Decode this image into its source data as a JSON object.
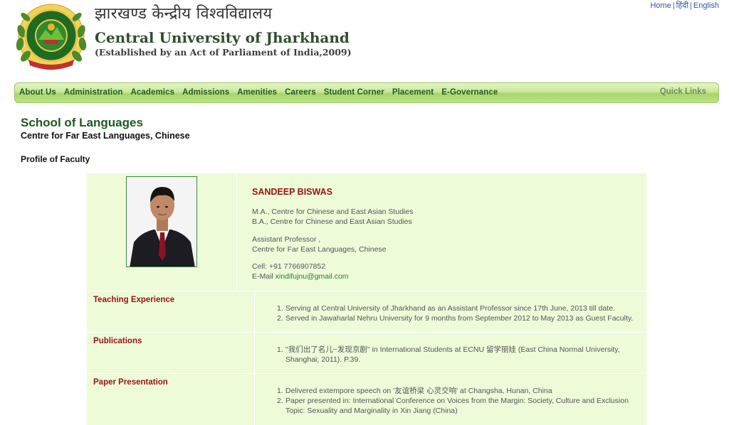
{
  "header": {
    "title_hindi": "झारखण्ड केन्द्रीय विश्वविद्यालय",
    "title_en": "Central University of Jharkhand",
    "subtitle": "(Established by an Act of Parliament of India,2009)",
    "toplinks": [
      "Home",
      "हिंदी",
      "English"
    ]
  },
  "nav": {
    "items": [
      "About Us",
      "Administration",
      "Academics",
      "Admissions",
      "Amenities",
      "Careers",
      "Student Corner",
      "Placement",
      "E-Governance"
    ],
    "quick_links": "Quick Links"
  },
  "page": {
    "school": "School of Languages",
    "centre": "Centre for Far East Languages, Chinese",
    "profile_heading": "Profile of Faculty"
  },
  "profile": {
    "name": "SANDEEP BISWAS",
    "qualifications": [
      "M.A., Centre for Chinese and East Asian Studies",
      "B.A., Centre for Chinese and East Asian Studies"
    ],
    "designation": "Assistant Professor ,",
    "department": "Centre for Far East Languages, Chinese",
    "cell": "Cell: +91 7766907852",
    "email_label": "E-Mail ",
    "email": "xindifujnu@gmail.com"
  },
  "sections": [
    {
      "label": "Teaching Experience",
      "items": [
        "Serving at Central University of Jharkhand as an Assistant Professor since 17th June, 2013 till date.",
        "Served in Jawaharlal Nehru University for 9 months from September 2012 to May 2013 as Guest Faculty."
      ]
    },
    {
      "label": "Publications",
      "items": [
        "\"我们出了名儿~发现京剧\" in International Students at ECNU 留学丽娃 (East China Normal University, Shanghai; 2011). P.39."
      ]
    },
    {
      "label": "Paper Presentation",
      "items": [
        "Delivered extempore speech on '友谊桥梁 心灵交响' at Changsha, Hunan, China",
        "Paper presented in: International Conference on Voices from the Margin: Society, Culture and Exclusion Topic: Sexuality and Marginality in Xin Jiang (China)"
      ]
    }
  ],
  "colors": {
    "nav_text": "#1f5d20",
    "heading_green": "#1e5a1e",
    "label_red": "#9a1212",
    "panel_bg": "#edfbd9"
  }
}
